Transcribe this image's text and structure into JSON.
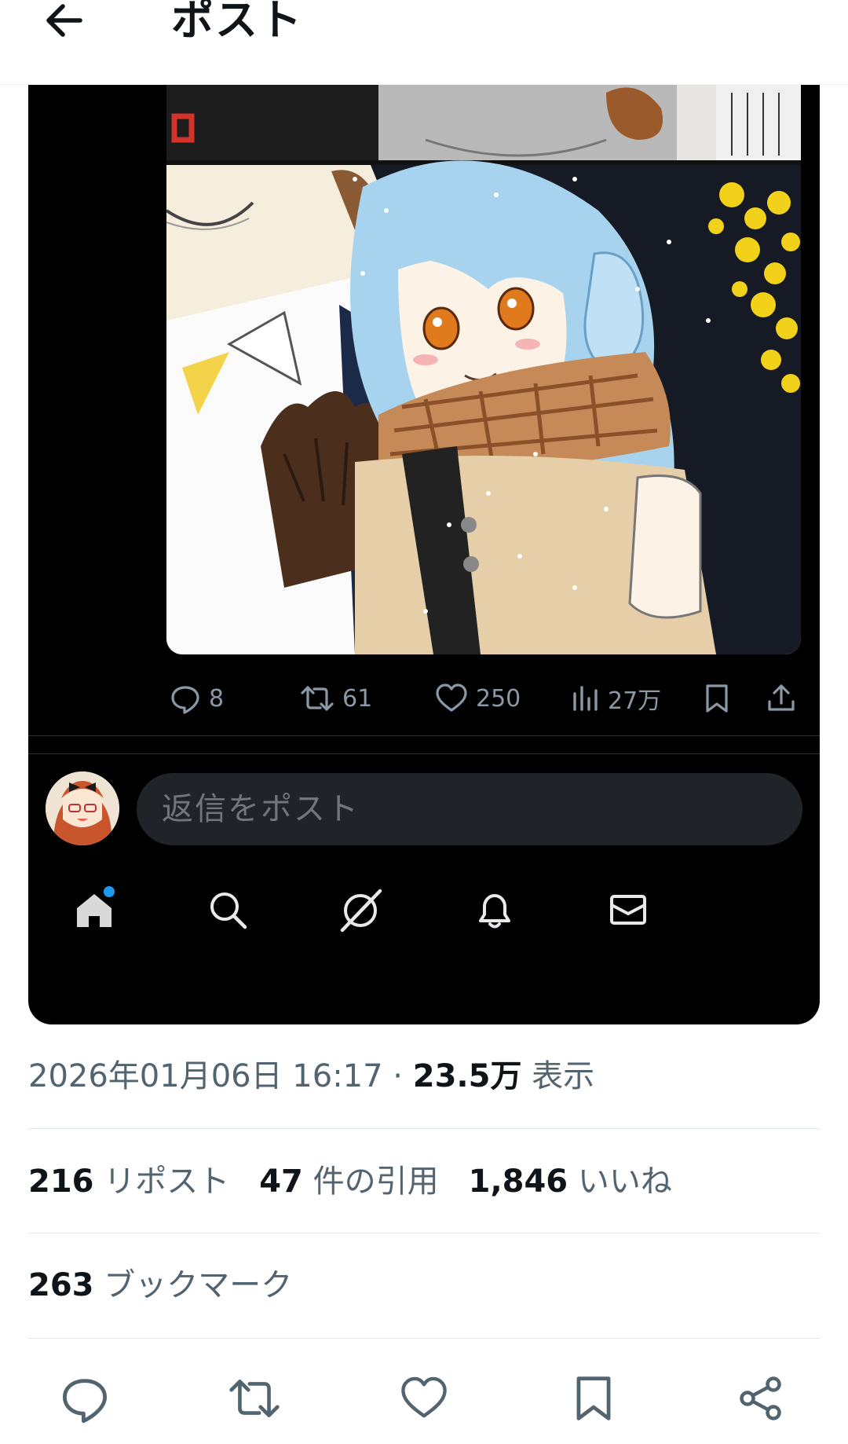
{
  "header": {
    "back_icon": "arrow-left-icon",
    "title": "ポスト"
  },
  "embed": {
    "actions": [
      {
        "icon": "reply-icon",
        "count": "8"
      },
      {
        "icon": "repost-icon",
        "count": "61"
      },
      {
        "icon": "like-icon",
        "count": "250"
      },
      {
        "icon": "views-icon",
        "count": "27万"
      },
      {
        "icon": "bookmark-icon",
        "count": ""
      },
      {
        "icon": "share-icon",
        "count": ""
      }
    ],
    "reply_placeholder": "返信をポスト",
    "tabbar": [
      "home-icon",
      "search-icon",
      "grok-icon",
      "bell-icon",
      "mail-icon"
    ],
    "colors": {
      "background": "#000000",
      "muted": "#8b98a5",
      "input_bg": "#202327",
      "accent": "#1d9bf0"
    }
  },
  "post": {
    "date": "2026年01月06日 16:17",
    "dot": " · ",
    "views_number": "23.5万",
    "views_label": " 表示",
    "reposts_number": "216",
    "reposts_label": " リポスト",
    "quotes_number": "47",
    "quotes_label": " 件の引用",
    "likes_number": "1,846",
    "likes_label": " いいね",
    "bookmarks_number": "263",
    "bookmarks_label": " ブックマーク"
  },
  "bottom_actions": [
    "reply-icon",
    "repost-icon",
    "like-icon",
    "bookmark-icon",
    "share-icon"
  ]
}
